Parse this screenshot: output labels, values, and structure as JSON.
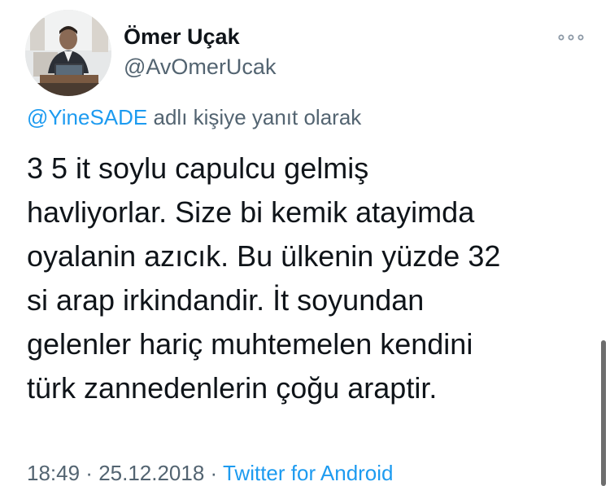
{
  "author": {
    "display_name": "Ömer Uçak",
    "handle": "@AvOmerUcak"
  },
  "icons": {
    "more": "more-horizontal-icon",
    "avatar": "profile-photo"
  },
  "reply_context": {
    "mention": "@YineSADE",
    "suffix": " adlı kişiye yanıt olarak"
  },
  "tweet": {
    "lines": [
      "3 5 it soylu capulcu gelmiş",
      "havliyorlar. Size bi kemik atayimda",
      "oyalanin azıcık. Bu ülkenin yüzde 32",
      "si arap irkindandir. İt soyundan",
      "gelenler hariç muhtemelen kendini",
      "türk zannedenlerin çoğu araptir."
    ]
  },
  "meta": {
    "time": "18:49",
    "separator": " · ",
    "date": "25.12.2018",
    "source": "Twitter for Android"
  },
  "colors": {
    "text": "#0f1419",
    "secondary": "#536471",
    "link": "#1d9bf0",
    "background": "#ffffff"
  }
}
